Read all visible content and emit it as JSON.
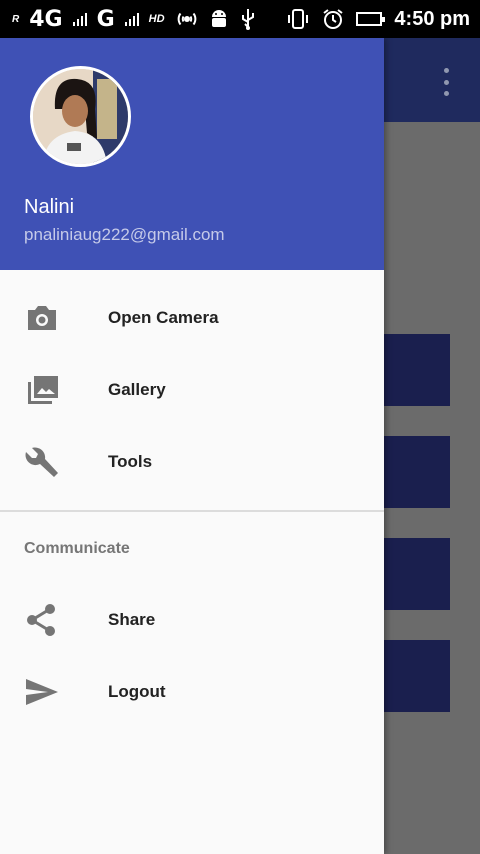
{
  "status_bar": {
    "roaming": "R",
    "network_1": "4G",
    "network_2": "G",
    "sim_2": "2",
    "hd": "HD",
    "time": "4:50 pm"
  },
  "drawer": {
    "header": {
      "name": "Nalini",
      "email": "pnaliniaug222@gmail.com"
    },
    "items": [
      {
        "label": "Open Camera",
        "icon": "camera-icon"
      },
      {
        "label": "Gallery",
        "icon": "gallery-icon"
      },
      {
        "label": "Tools",
        "icon": "wrench-icon"
      }
    ],
    "section_title": "Communicate",
    "section_items": [
      {
        "label": "Share",
        "icon": "share-icon"
      },
      {
        "label": "Logout",
        "icon": "send-icon"
      }
    ]
  },
  "colors": {
    "header_bg": "#3f51b5",
    "drawer_bg": "#fafafa",
    "scrim_bg": "#6b6b6b",
    "app_bar_bg": "#1f2a5e"
  }
}
